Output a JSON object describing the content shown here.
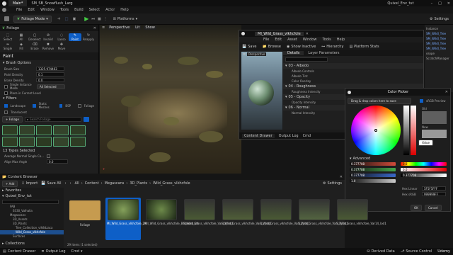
{
  "title_bar": {
    "tabs": [
      "Main*",
      "SM_SB_Snowflush_Larg"
    ],
    "project_name": "Quixel_Env_tut"
  },
  "main_menu": [
    "File",
    "Edit",
    "Window",
    "Tools",
    "Build",
    "Select",
    "Actor",
    "Help"
  ],
  "toolbar": {
    "mode": "Foliage Mode",
    "platforms": "Platforms",
    "settings": "Settings"
  },
  "foliage": {
    "panel_title": "Foliage",
    "tools": [
      "Select",
      "All",
      "Deselect",
      "Invalid",
      "Lasso",
      "Paint",
      "Reapply",
      "Single",
      "Fill",
      "Erase",
      "Remove",
      "Move"
    ],
    "paint_header": "Paint",
    "brush_options_header": "Brush Options",
    "brush_size_label": "Brush Size",
    "brush_size_value": "1325.974463",
    "paint_density_label": "Paint Density",
    "paint_density_value": "0.1",
    "erase_density_label": "Erase Density",
    "erase_density_value": "0.0",
    "single_instance_label": "Single Instance Mode",
    "single_instance_value": "All Selected",
    "place_cursor_label": "Place in Current Level",
    "filters_header": "Filters",
    "filter_landscape": "Landscape",
    "filter_static": "Static Meshes",
    "filter_bsp": "BSP",
    "filter_foliage": "Foliage",
    "filter_translucent": "Translucent",
    "add_button": "+ Foliage",
    "search_placeholder": "Search Foliage",
    "types_selected": "13 Types Selected",
    "avg_normal_label": "Average Normal Single Co...",
    "align_max_label": "Align Max Angle",
    "align_max_value": "0.0"
  },
  "viewport": {
    "perspective": "Perspective",
    "lit": "Lit",
    "show": "Show"
  },
  "right_outliner": {
    "items": [
      "Instance",
      "SM_Wildl_Tree",
      "SM_Wildl_Tree",
      "SM_Wildl_Tree",
      "SM_Wildl_Tree",
      "osope",
      "ScratchManager"
    ]
  },
  "material_editor": {
    "window_title": "MI_Wild_Grass_vlkhcfole",
    "menu": [
      "File",
      "Edit",
      "Asset",
      "Window",
      "Tools",
      "Help"
    ],
    "save": "Save",
    "browse": "Browse",
    "show_inactive": "Show Inactive",
    "hierarchy": "Hierarchy",
    "platform_stats": "Platform Stats",
    "preview_mode": "Perspective",
    "details_tab": "Details",
    "layer_params_tab": "Layer Parameters",
    "groups": [
      "03 - Albedo",
      "04 - Roughness",
      "05 - Opacity",
      "06 - Normal"
    ],
    "albedo_params": [
      "Albedo Controls",
      "Albedo Tint",
      "Color Overlay"
    ],
    "roughness_params": [
      "Roughness Intensity"
    ],
    "opacity_params": [
      "Opacity Intensity"
    ],
    "normal_params": [
      "Normal Intensity"
    ],
    "content_drawer": "Content Drawer",
    "output_log": "Output Log",
    "cmd": "Cmd"
  },
  "color_picker": {
    "title": "Color Picker",
    "dropdown": "Drag & drop colors here to save",
    "srgb_preview": "sRGB Preview",
    "old_label": "Old",
    "new_label": "New",
    "value_label": "Value",
    "advanced": "Advanced",
    "channels": [
      {
        "value": "0.377708",
        "color": "#d14b3a"
      },
      {
        "value": "0.377708",
        "color": "#44a84a"
      },
      {
        "value": "0.377708",
        "color": "#3a68c9"
      },
      {
        "value": "1.0",
        "color": "#cccccc"
      }
    ],
    "hsv": [
      {
        "label": "H",
        "value": "0.0"
      },
      {
        "label": "S",
        "value": "0.0"
      },
      {
        "label": "V",
        "value": "0.377708"
      }
    ],
    "hex_linear_label": "Hex Linear",
    "hex_linear_value": "5F5F5FFF",
    "hex_srgb_label": "Hex sRGB",
    "hex_srgb_value": "999999FF",
    "ok": "OK",
    "cancel": "Cancel"
  },
  "content_browser": {
    "title": "Content Browser",
    "add": "+ Add",
    "import": "Import",
    "save_all": "Save All",
    "breadcrumb": [
      "All",
      "Content",
      "Megascans",
      "3D_Plants",
      "Wild_Grass_vlkhcfole"
    ],
    "settings": "Settings",
    "search_placeholder": "Search Wild_Grass_vlkhcfole",
    "favorites": "Favorites",
    "project": "Quixel_Env_tut",
    "tree": [
      "FAB",
      "6330_Valhalla",
      "Megascans",
      "3D_Assets",
      "3D_Plants",
      "Tree_Collection_vlh8dzaca",
      "Wild_Grass_vlkhcfole",
      "Surfaces"
    ],
    "collections": "Collections",
    "items": [
      {
        "label": "Foliage"
      },
      {
        "label": "MI_Wild_Grass_vlkhcfole_2K"
      },
      {
        "label": "MI_Wild_Grass_vlkhcfole_Billboard_2K"
      },
      {
        "label": "S_Wild_Grass_vlkhcfole_Var10_lod1"
      },
      {
        "label": "S_Wild_Grass_vlkhcfole_Var11_lod1"
      },
      {
        "label": "S_Wild_Grass_vlkhcfole_Var12_lod1"
      },
      {
        "label": "S_Wild_Grass_vlkhcfole_Var13_lod1"
      },
      {
        "label": "S_Wild_Grass_vlkhcfole_Var14_lod1"
      }
    ],
    "item_count": "29 items (1 selected)"
  },
  "status_bar": {
    "content_drawer": "Content Drawer",
    "output_log": "Output Log",
    "cmd": "Cmd",
    "derived_data": "Derived Data",
    "source_control": "Source Control",
    "udemy": "Udemy"
  }
}
